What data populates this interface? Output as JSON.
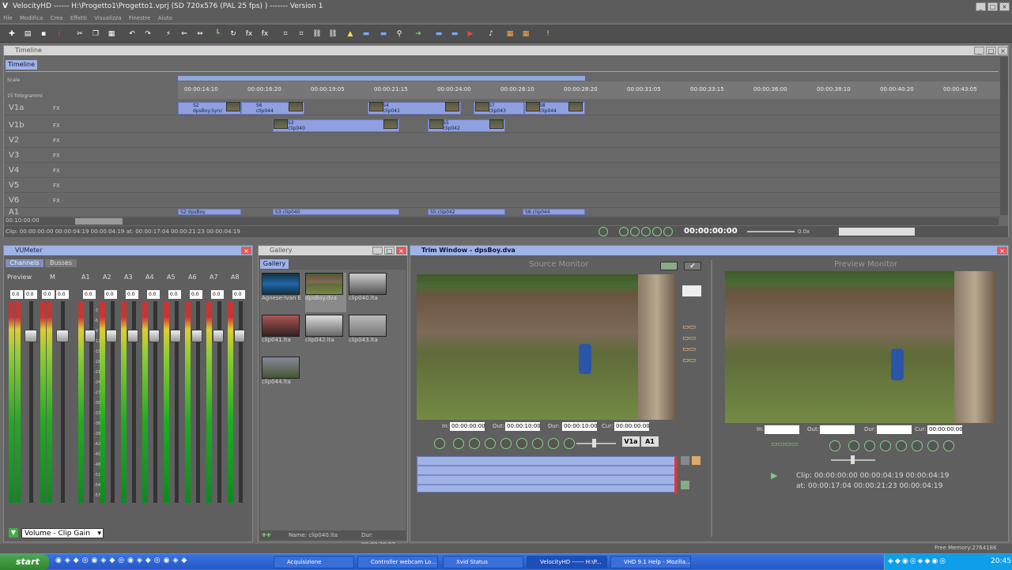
{
  "app": {
    "title": "VelocityHD ------ H:\\Progetto1\\Progetto1.vprj (SD 720x576 (PAL 25 fps) ) ------- Version 1",
    "menu": [
      "File",
      "Modifica",
      "Crea",
      "Effetti",
      "Visualizza",
      "Finestre",
      "Aiuto"
    ]
  },
  "timeline": {
    "panel_title": "Timeline",
    "tab": "Timeline",
    "scale_label": "Scale",
    "frames_label": "15 fotogrammi",
    "ticks": [
      "00:00:14:10",
      "00:00:16:20",
      "00:00:19:05",
      "00:00:21:15",
      "00:00:24:00",
      "00:00:26:10",
      "00:00:28:20",
      "00:00:31:05",
      "00:00:33:15",
      "00:00:36:00",
      "00:00:38:10",
      "00:00:40:20",
      "00:00:43:05"
    ],
    "tracks": [
      "V1a",
      "V1b",
      "V2",
      "V3",
      "V4",
      "V5",
      "V6",
      "A1"
    ],
    "track_tools": "FX",
    "clips_v1a": [
      {
        "scene": "S2",
        "name": "dpsBoy.Sync"
      },
      {
        "scene": "S6",
        "name": "clip044"
      },
      {
        "scene": "S4",
        "name": "clip041",
        "extra": "Sync"
      },
      {
        "scene": "S7",
        "name": "clip043"
      },
      {
        "scene": "S8",
        "name": "clip044",
        "extra": "Sync"
      }
    ],
    "clips_v1b": [
      {
        "scene": "S3",
        "name": "clip040",
        "extra": "Sync"
      },
      {
        "scene": "S5",
        "name": "clip042",
        "extra": "Sync"
      }
    ],
    "clips_a1": [
      "S2:dpsBoy",
      "S3:clip040",
      "S5:clip042",
      "S8:clip044"
    ],
    "status_line": "Clip: 00:00:00:00  00:00:04:19  00:00:04:19   at: 00:00:17:04  00:00:21:23  00:00:04:19",
    "timecode_left": "00:10:00:00",
    "current_time": "00:00:00:00",
    "zoom_label": "0.0x"
  },
  "vumeter": {
    "title": "VUMeter",
    "tabs": [
      "Channels",
      "Busses"
    ],
    "channels": [
      "Preview",
      "M",
      "A1",
      "A2",
      "A3",
      "A4",
      "A5",
      "A6",
      "A7",
      "A8"
    ],
    "value": "0.0",
    "scale": [
      "-3",
      "-6",
      "-9",
      "-12",
      "-15",
      "-18",
      "-21",
      "-24",
      "-27",
      "-30",
      "-33",
      "-36",
      "-39",
      "-42",
      "-45",
      "-48",
      "-51",
      "-54",
      "-57"
    ],
    "dropdown": "Volume - Clip Gain"
  },
  "gallery": {
    "title": "Gallery",
    "tab": "Gallery",
    "items": [
      "Agnese-Ivan E",
      "dpsBoy.dva",
      "clip040.lta",
      "clip041.lta",
      "clip042.lta",
      "clip043.lta",
      "clip044.lta"
    ],
    "status_name": "Name: clip040.lta",
    "status_dur": "Dur: 00:00:20:03"
  },
  "trim": {
    "title": "Trim Window - dpsBoy.dva",
    "source_label": "Source Monitor",
    "preview_label": "Preview Monitor",
    "source": {
      "in_label": "In:",
      "in": "00:00:00:00",
      "out_label": "Out:",
      "out": "00:00:10:00",
      "dur_label": "Dur:",
      "dur": "00:00:10:00",
      "cur_label": "Cur:",
      "cur": "00:00:00:00"
    },
    "preview": {
      "in_label": "In:",
      "out_label": "Out:",
      "dur_label": "Dur:",
      "cur_label": "Cur:",
      "cur": "00:00:00:00"
    },
    "track_buttons": [
      "V1a",
      "A1"
    ],
    "clip_info": "Clip: 00:00:00:00  00:00:04:19  00:00:04:19",
    "at_info": "at: 00:00:17:04  00:00:21:23  00:00:04:19"
  },
  "footer": {
    "memory": "Free Memory:276418K"
  },
  "taskbar": {
    "start": "start",
    "tasks": [
      "Acquisizione",
      "Controller webcam Lo...",
      "Xvid Status",
      "VelocityHD ------ H:\\P...",
      "VHD 9.1 Help - Mozilla..."
    ],
    "clock": "20:45"
  }
}
